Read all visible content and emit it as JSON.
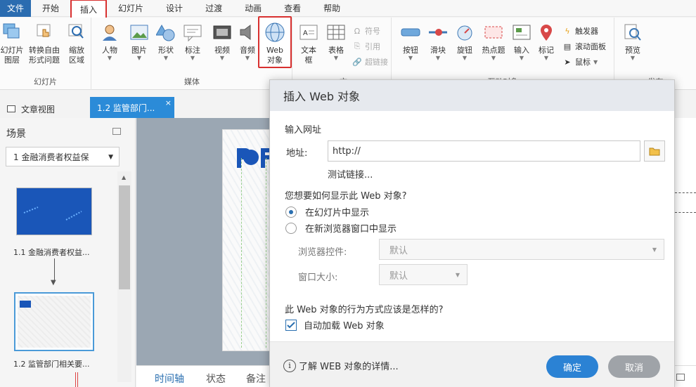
{
  "menubar": {
    "file": "文件",
    "items": [
      "开始",
      "插入",
      "幻灯片",
      "设计",
      "过渡",
      "动画",
      "查看",
      "帮助"
    ]
  },
  "ribbon": {
    "groups": {
      "slide": "幻灯片",
      "media": "媒体",
      "text_partial": "文",
      "interactive_partial": "互动对象",
      "preview_partial": "发布"
    },
    "buttons": {
      "slide_layer": "幻灯片\n图层",
      "convert": "转换自由\n形式问题",
      "zoom": "缩放\n区域",
      "character": "人物",
      "picture": "图片",
      "shape": "形状",
      "caption": "标注",
      "video": "视频",
      "audio": "音频",
      "web": "Web\n对象",
      "textbox": "文本\n框",
      "table": "表格",
      "button": "按钮",
      "slider": "滑块",
      "dial": "旋钮",
      "hotspot": "热点题",
      "input": "输入",
      "marker": "标记",
      "preview": "预览"
    },
    "small_text": [
      "符号",
      "引用",
      "超链接"
    ],
    "small_interactive": [
      "触发器",
      "滚动面板",
      "鼠标"
    ]
  },
  "tabs": {
    "doc_view": "文章视图",
    "slide_tab": "1.2 监管部门...",
    "close": "×"
  },
  "scene": {
    "title": "场景",
    "selected": "1 金融消费者权益保",
    "thumb1_label": "1.1 金融消费者权益...",
    "thumb2_label": "1.2 监管部门相关要..."
  },
  "bottom_tabs": [
    "时间轴",
    "状态",
    "备注"
  ],
  "dialog": {
    "title": "插入 Web 对象",
    "url_section": "输入网址",
    "address_label": "地址:",
    "address_value": "http://",
    "test_link": "测试链接...",
    "display_question": "您想要如何显示此 Web 对象?",
    "radio_in_slide": "在幻灯片中显示",
    "radio_new_window": "在新浏览器窗口中显示",
    "browser_control_label": "浏览器控件:",
    "browser_control_value": "默认",
    "window_size_label": "窗口大小:",
    "window_size_value": "默认",
    "behavior_question": "此 Web 对象的行为方式应该是怎样的?",
    "autoload_label": "自动加载 Web 对象",
    "info_text": "了解 WEB 对象的详情...",
    "ok": "确定",
    "cancel": "取消"
  },
  "colors": {
    "accent_blue": "#2b82d4",
    "highlight_red": "#d8302f",
    "tab_blue": "#2b8bd8"
  }
}
